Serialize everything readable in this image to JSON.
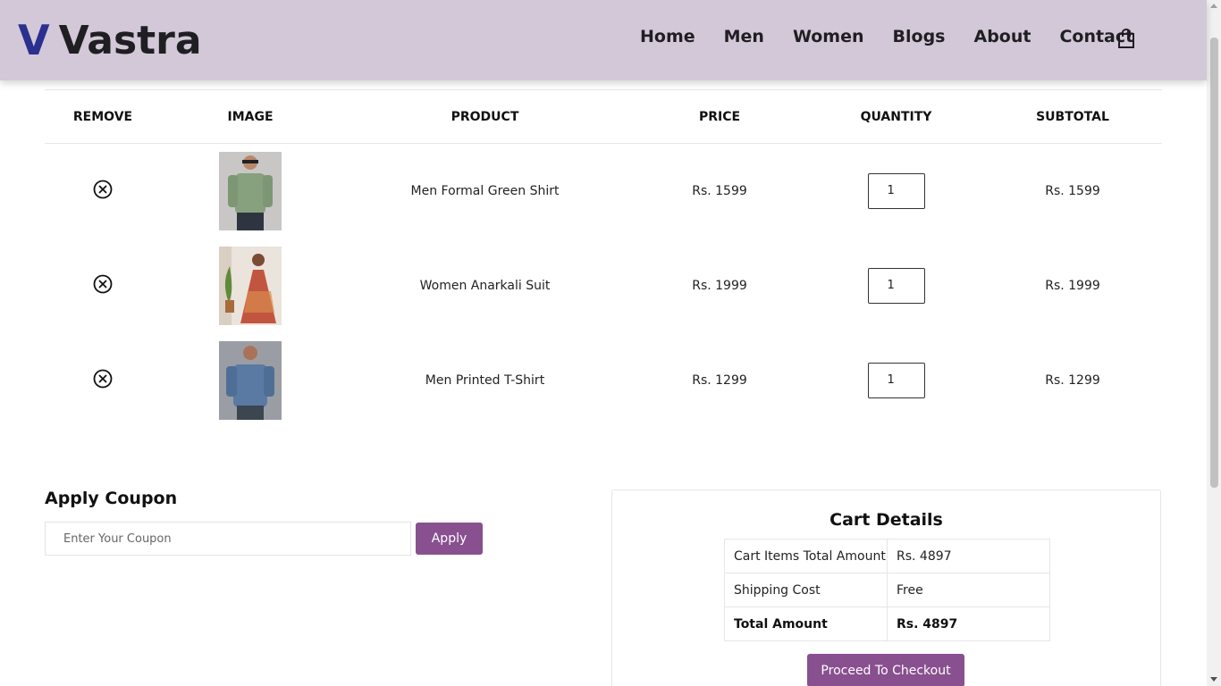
{
  "brand": {
    "mark": "V",
    "name": "Vastra"
  },
  "nav": {
    "items": [
      "Home",
      "Men",
      "Women",
      "Blogs",
      "About",
      "Contact"
    ]
  },
  "cart_table": {
    "headers": [
      "REMOVE",
      "IMAGE",
      "PRODUCT",
      "PRICE",
      "QUANTITY",
      "SUBTOTAL"
    ],
    "rows": [
      {
        "product": "Men Formal Green Shirt",
        "price": "Rs. 1599",
        "quantity": "1",
        "subtotal": "Rs. 1599"
      },
      {
        "product": "Women Anarkali Suit",
        "price": "Rs. 1999",
        "quantity": "1",
        "subtotal": "Rs. 1999"
      },
      {
        "product": "Men Printed T-Shirt",
        "price": "Rs. 1299",
        "quantity": "1",
        "subtotal": "Rs. 1299"
      }
    ]
  },
  "coupon": {
    "title": "Apply Coupon",
    "placeholder": "Enter Your Coupon",
    "button": "Apply"
  },
  "cart_details": {
    "title": "Cart Details",
    "rows": [
      {
        "label": "Cart Items Total Amount",
        "value": "Rs. 4897"
      },
      {
        "label": "Shipping Cost",
        "value": "Free"
      },
      {
        "label": "Total Amount",
        "value": "Rs. 4897"
      }
    ],
    "checkout_button": "Proceed To Checkout"
  },
  "icons": {
    "cart": "shopping-bag-icon",
    "remove": "circle-x-icon"
  },
  "colors": {
    "header_bg": "#d3c8d7",
    "brand_mark": "#2b2f8f",
    "button": "#88508f"
  }
}
